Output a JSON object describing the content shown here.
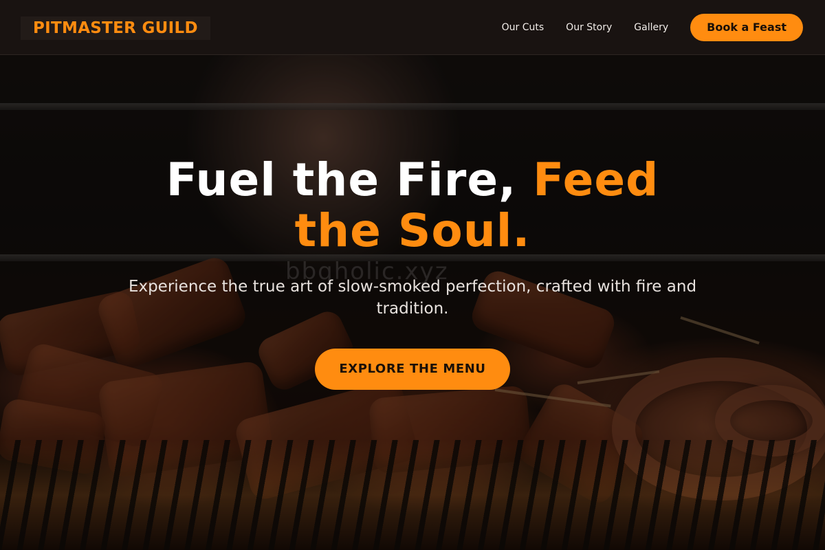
{
  "header": {
    "logo": "PITMASTER GUILD",
    "nav": [
      {
        "label": "Our Cuts"
      },
      {
        "label": "Our Story"
      },
      {
        "label": "Gallery"
      }
    ],
    "cta_label": "Book a Feast"
  },
  "hero": {
    "title_part1": "Fuel the Fire, ",
    "title_part2": "Feed the Soul.",
    "watermark": "bbqholic.xyz",
    "subtitle": "Experience the true art of slow-smoked perfection, crafted with fire and tradition.",
    "cta_label": "EXPLORE THE MENU"
  },
  "colors": {
    "accent": "#ff8c10",
    "header_bg": "#1a1412",
    "text_light": "#ffffff"
  }
}
